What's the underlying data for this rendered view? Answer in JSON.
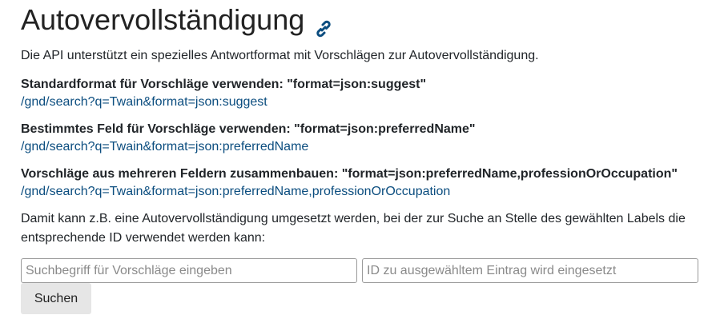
{
  "heading": {
    "title": "Autovervollständigung",
    "icon": "link-icon",
    "icon_color": "#0b4d7f"
  },
  "intro": "Die API unterstützt ein spezielles Antwortformat mit Vorschlägen zur Autovervollständigung.",
  "examples": [
    {
      "label": "Standardformat für Vorschläge verwenden: \"format=json:suggest\"",
      "link": "/gnd/search?q=Twain&format=json:suggest"
    },
    {
      "label": "Bestimmtes Feld für Vorschläge verwenden: \"format=json:preferredName\"",
      "link": "/gnd/search?q=Twain&format=json:preferredName"
    },
    {
      "label": "Vorschläge aus mehreren Feldern zusammenbauen: \"format=json:preferredName,professionOrOccupation\"",
      "link": "/gnd/search?q=Twain&format=json:preferredName,professionOrOccupation"
    }
  ],
  "description": "Damit kann z.B. eine Autovervollständigung umgesetzt werden, bei der zur Suche an Stelle des gewählten Labels die entsprechende ID verwendet werden kann:",
  "form": {
    "query_placeholder": "Suchbegriff für Vorschläge eingeben",
    "id_placeholder": "ID zu ausgewähltem Eintrag wird eingesetzt",
    "submit_label": "Suchen"
  },
  "colors": {
    "link": "#0b4d7f",
    "button_bg": "#e6e6e6"
  }
}
